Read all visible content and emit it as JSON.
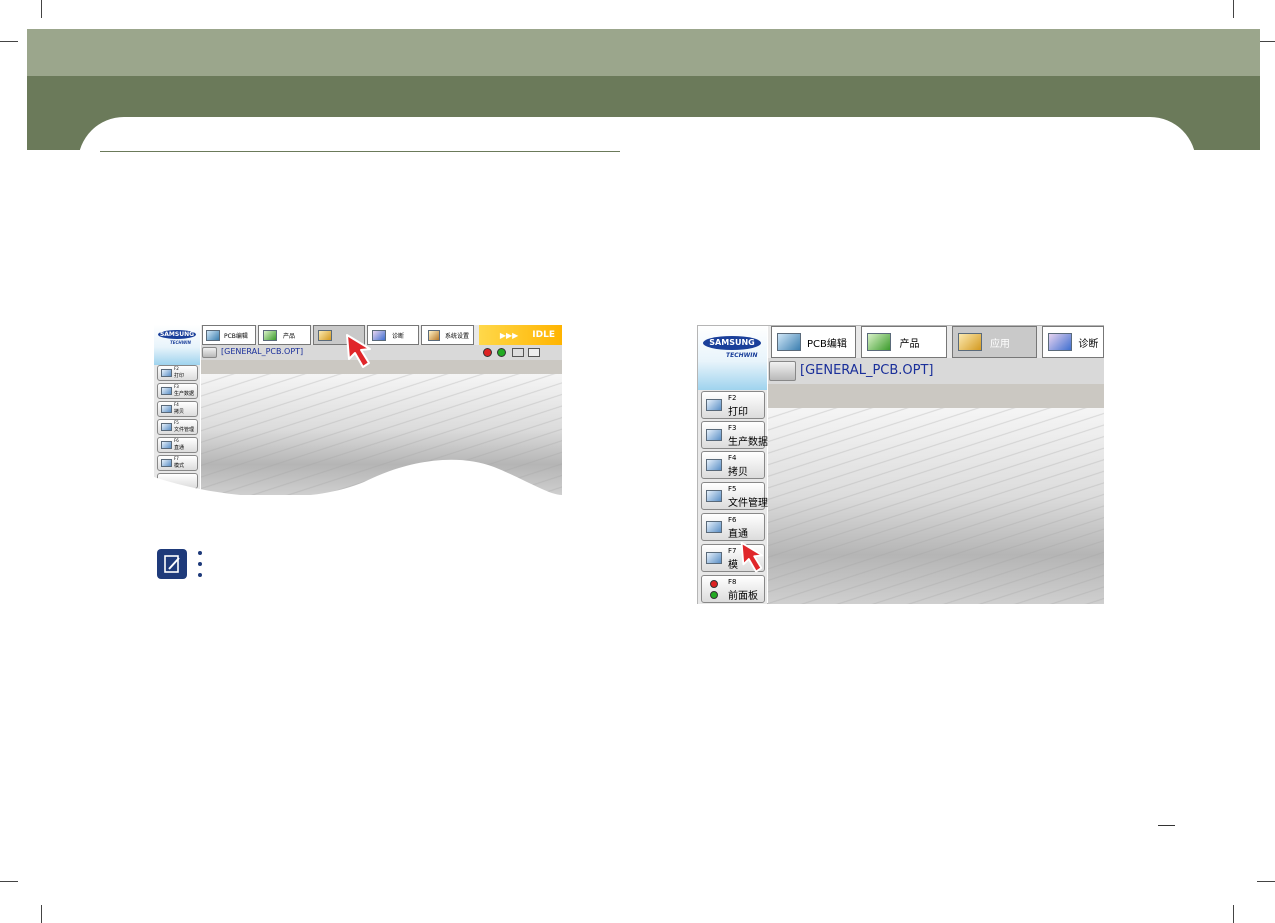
{
  "header": {
    "accent": "#6b7a5a",
    "accent_light": "#9ba68c"
  },
  "small_screen": {
    "logo": {
      "brand": "SAMSUNG",
      "sub": "TECHWIN"
    },
    "tabs": [
      {
        "label": "PCB编辑",
        "icon": "pcb-icon"
      },
      {
        "label": "产品",
        "icon": "product-icon"
      },
      {
        "label": "",
        "icon": "folder-icon",
        "active": true
      },
      {
        "label": "诊断",
        "icon": "diagnostic-icon"
      },
      {
        "label": "系统设置",
        "icon": "settings-icon"
      }
    ],
    "status": "IDLE",
    "status_arrows": "▶▶▶",
    "file": "[GENERAL_PCB.OPT]",
    "side_buttons": [
      {
        "key": "F2",
        "name": "打印"
      },
      {
        "key": "F3",
        "name": "生产数据"
      },
      {
        "key": "F4",
        "name": "拷贝"
      },
      {
        "key": "F5",
        "name": "文件管理"
      },
      {
        "key": "F6",
        "name": "直通"
      },
      {
        "key": "F7",
        "name": "模式"
      }
    ]
  },
  "large_screen": {
    "logo": {
      "brand": "SAMSUNG",
      "sub": "TECHWIN"
    },
    "tabs": [
      {
        "label": "PCB编辑",
        "icon": "pcb-icon"
      },
      {
        "label": "产品",
        "icon": "product-icon"
      },
      {
        "label": "应用",
        "icon": "folder-icon",
        "active": true
      },
      {
        "label": "诊断",
        "icon": "diagnostic-icon"
      }
    ],
    "file": "[GENERAL_PCB.OPT]",
    "side_buttons": [
      {
        "key": "F2",
        "name": "打印"
      },
      {
        "key": "F3",
        "name": "生产数据"
      },
      {
        "key": "F4",
        "name": "拷贝"
      },
      {
        "key": "F5",
        "name": "文件管理"
      },
      {
        "key": "F6",
        "name": "直通"
      },
      {
        "key": "F7",
        "name": "模"
      },
      {
        "key": "F8",
        "name": "前面板"
      }
    ]
  }
}
